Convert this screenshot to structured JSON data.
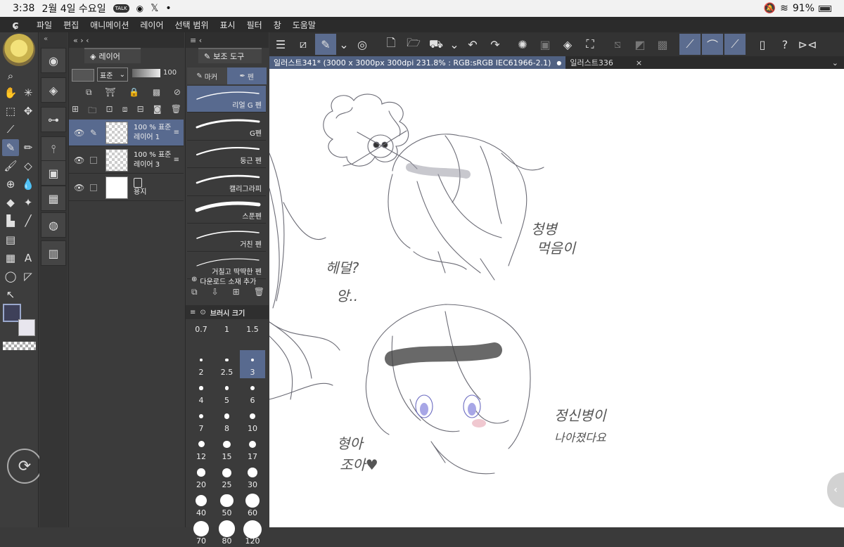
{
  "status": {
    "time": "3:38",
    "date": "2월 4일 수요일",
    "talk": "TALK",
    "x": "𝕏",
    "dot": "•",
    "battery": "91%"
  },
  "menu": [
    "파일",
    "편집",
    "애니메이션",
    "레이어",
    "선택 범위",
    "표시",
    "필터",
    "창",
    "도움말"
  ],
  "layer_panel": {
    "title": "레이어",
    "blend": "표준",
    "opacity": "100",
    "layers": [
      {
        "mode": "100 % 표준",
        "name": "레이어 1"
      },
      {
        "mode": "100 % 표준",
        "name": "레이어 3"
      },
      {
        "mode": "",
        "name": "용지"
      }
    ]
  },
  "subtool_panel": {
    "title": "보조 도구",
    "tabs": [
      "마커",
      "펜"
    ],
    "brushes": [
      "리얼 G 펜",
      "G펜",
      "둥근 펜",
      "캘리그라피",
      "스푼펜",
      "거친 펜",
      "거칠고 딱딱한 펜"
    ],
    "download": "다운로드 소재 추가"
  },
  "brush_size": {
    "title": "브러시 크기",
    "sizes": [
      "0.7",
      "1",
      "1.5",
      "2",
      "2.5",
      "3",
      "4",
      "5",
      "6",
      "7",
      "8",
      "10",
      "12",
      "15",
      "17",
      "20",
      "25",
      "30",
      "40",
      "50",
      "60",
      "70",
      "80",
      "120"
    ],
    "selected": "3"
  },
  "doc_tabs": {
    "active": "일러스트341* (3000 x 3000px 300dpi 231.8% : RGB:sRGB IEC61966-2.1)",
    "other": "일러스트336",
    "close": "×"
  },
  "canvas_text": {
    "t1": "헤덜?",
    "t2": "앙..",
    "t3": "청병",
    "t4": "먹음이",
    "t5": "형아",
    "t6": "조아♥",
    "t7": "정신병이",
    "t8": "나아졌다요"
  }
}
